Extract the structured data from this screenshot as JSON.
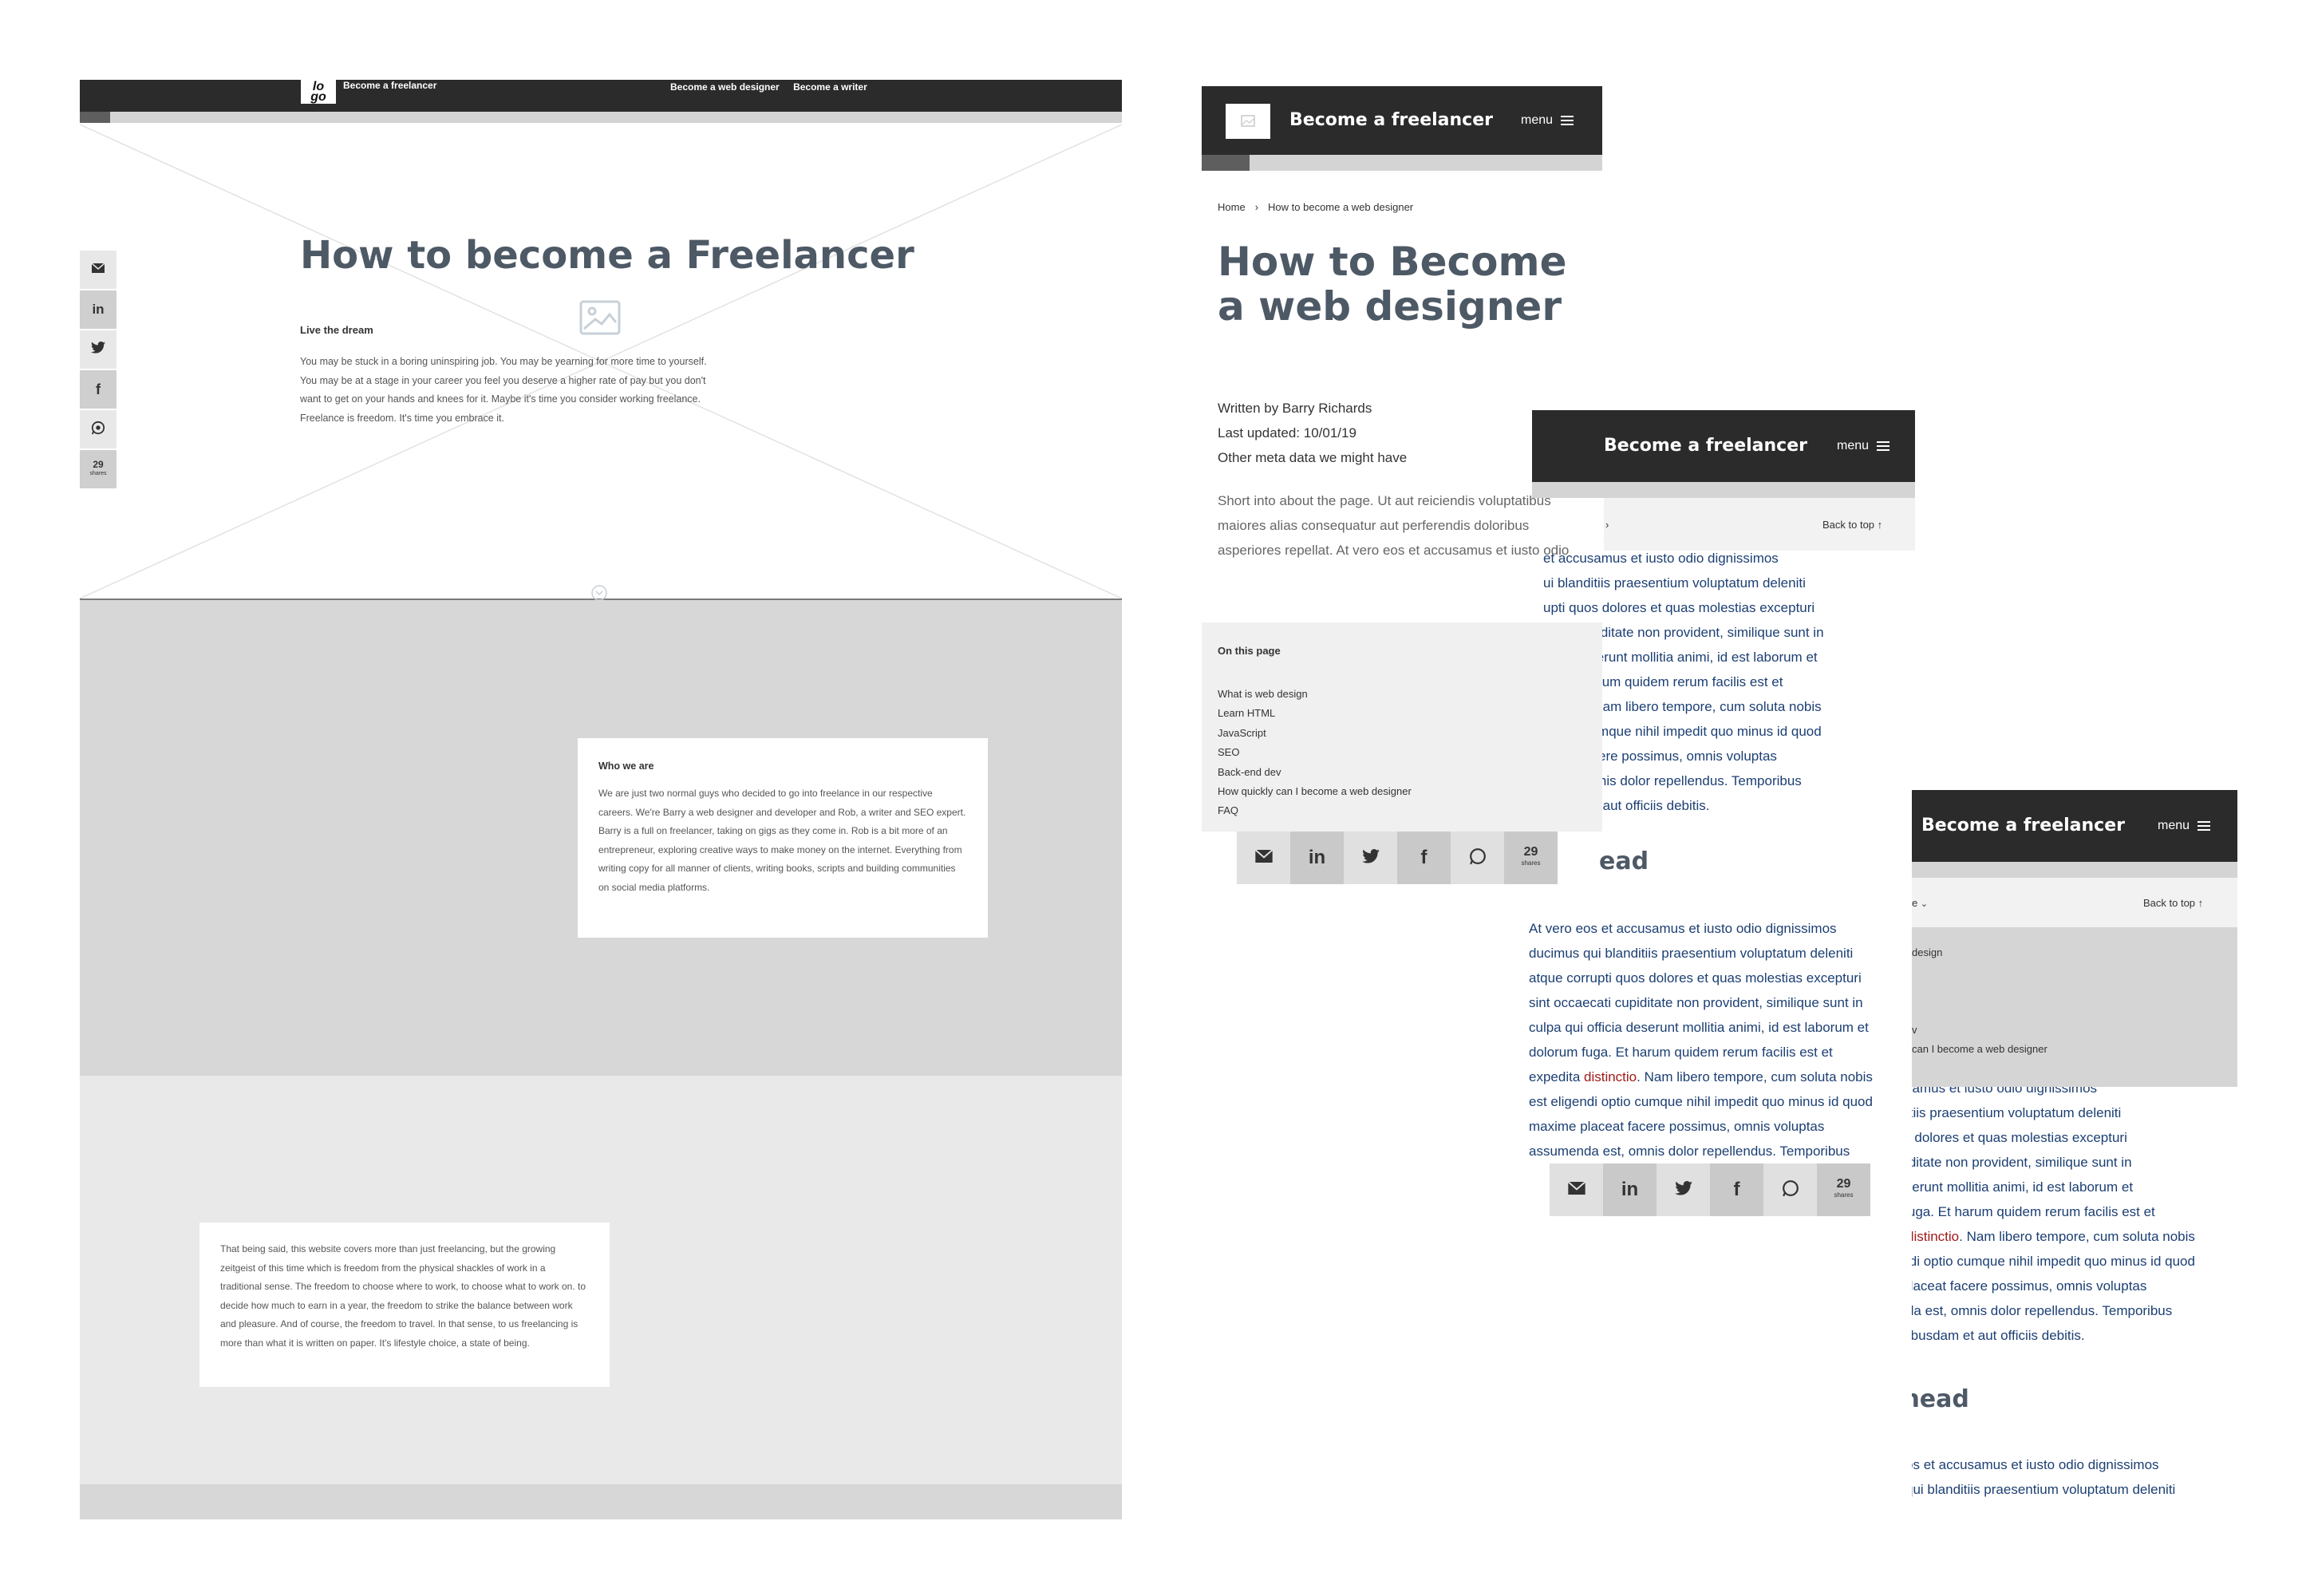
{
  "desktop": {
    "logo": "lo\ngo",
    "site_title": "Become a freelancer",
    "nav": [
      "Become a web designer",
      "Become a writer"
    ],
    "hero_title": "How to become a Freelancer",
    "hero_subtitle": "Live the dream",
    "hero_intro": "You may be stuck in a boring uninspiring job. You may be yearning for more time to yourself. You may be at a stage in your career you feel you deserve a higher rate of pay but you don't want to get on your hands and knees for it. Maybe it's time you consider working freelance. Freelance is freedom. It's time you embrace it.",
    "share_count": "29",
    "share_label": "shares",
    "who_title": "Who we are",
    "who_text": "We are just two normal guys who decided to go into freelance in our respective careers. We're Barry a web designer and developer and Rob, a writer and SEO expert. Barry is a full on freelancer, taking on gigs as they come in. Rob is a bit more of an entrepreneur, exploring creative ways to make money on the internet. Everything from writing copy for all manner of clients, writing books, scripts and building communities on social media platforms.",
    "freedom_text": "That being said, this website covers more than just freelancing, but the growing zeitgeist of this time which is freedom from the physical shackles of work in a traditional sense. The freedom to choose where to work, to choose what to work on. to decide how much to earn in a year, the freedom to strike the balance between work and pleasure. And of course, the freedom to travel. In that sense, to us freelancing is more than what it is written on paper. It's lifestyle choice, a state of being."
  },
  "mobile": {
    "site_title": "Become a freelancer",
    "menu_label": "menu",
    "breadcrumb": [
      "Home",
      "How to become a web designer"
    ],
    "page_title": "How to Become a web designer",
    "meta": [
      "Written by Barry Richards",
      "Last updated: 10/01/19",
      "Other meta data we might have"
    ],
    "intro": "Short into about the page. Ut aut reiciendis voluptatibus maiores alias consequatur aut perferendis doloribus asperiores repellat. At vero eos et accusamus et iusto odio",
    "toc_title": "On this page",
    "toc": [
      "What is web design",
      "Learn HTML",
      "JavaScript",
      "SEO",
      "Back-end dev",
      "How quickly can I become a web designer",
      "FAQ"
    ],
    "share_count": "29",
    "share_label": "shares",
    "back_to_top": "Back to top",
    "subhead_partial": "ead",
    "subhead": "Subhead",
    "m2_lines": [
      "et accusamus et iusto odio dignissimos",
      "ui blanditiis praesentium voluptatum deleniti",
      "upti quos dolores et quas molestias excepturi",
      "ecati cupiditate non provident, similique sunt in",
      "fficia deserunt mollitia animi, id est laborum et",
      "ga. Et harum quidem rerum facilis est et",
      "stinctio. Nam libero tempore, cum soluta nobis",
      "i optio cumque nihil impedit quo minus id quod",
      "aceat facere possimus, omnis voluptas",
      "a est, omnis dolor repellendus. Temporibus",
      "usdam et aut officiis debitis."
    ],
    "m2_para2": [
      "At vero eos et accusamus et iusto odio dignissimos",
      "ducimus qui blanditiis praesentium voluptatum deleniti",
      "atque corrupti quos dolores et quas molestias excepturi",
      "sint occaecati cupiditate non provident, similique sunt in",
      "culpa qui officia deserunt mollitia animi, id est laborum et",
      "dolorum fuga. Et harum quidem rerum facilis est et",
      "expedita distinctio. Nam libero tempore, cum soluta nobis",
      "est eligendi optio cumque nihil impedit quo minus id quod",
      "maxime placeat facere possimus, omnis voluptas",
      "assumenda est, omnis dolor repellendus. Temporibus"
    ],
    "m3_drop": [
      "e",
      "design",
      "",
      "",
      "v",
      "can I become a web designer"
    ],
    "m3_lines": [
      "s et accusamus et iusto odio dignissimos",
      "qui blanditiis praesentium voluptatum deleniti",
      "rupti quos dolores et quas molestias excepturi",
      "ecati cupiditate non provident, similique sunt in",
      " officia deserunt mollitia animi, id est laborum et",
      "dolorum fuga. Et harum quidem rerum facilis est et",
      "expedita distinctio. Nam libero tempore, cum soluta nobis",
      "est eligendi optio cumque nihil impedit quo minus id quod",
      "maxime placeat facere possimus, omnis voluptas",
      "assumenda est, omnis dolor repellendus. Temporibus",
      "autem quibusdam et aut officiis debitis."
    ],
    "m3_lines2": [
      "At vero eos et accusamus et iusto odio dignissimos",
      "ducimus qui blanditiis praesentium voluptatum deleniti"
    ]
  }
}
